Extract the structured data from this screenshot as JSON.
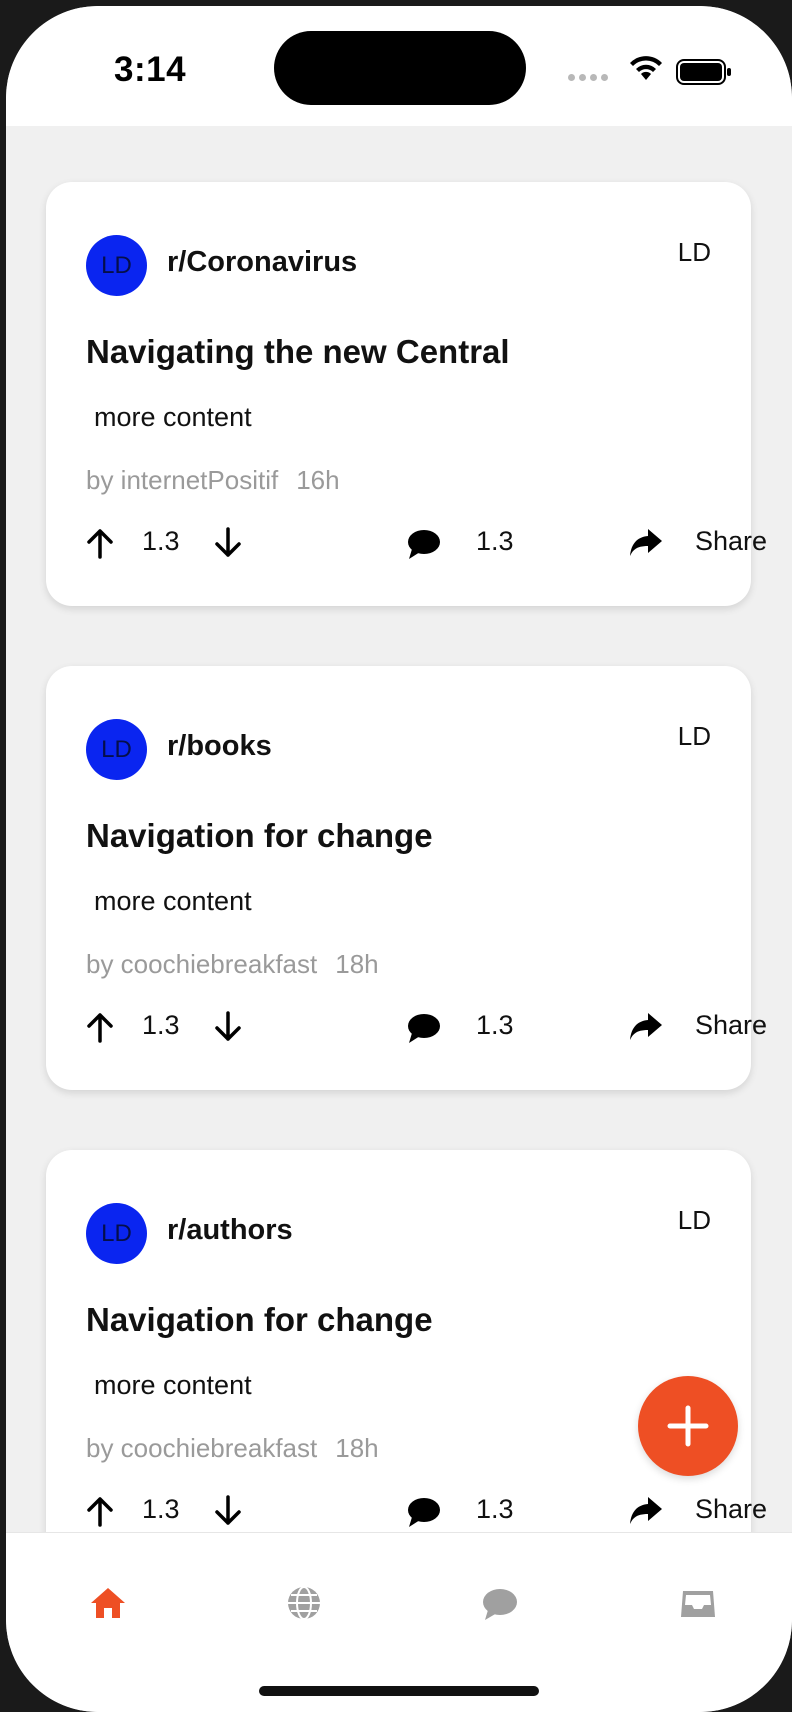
{
  "status_bar": {
    "time": "3:14"
  },
  "posts": [
    {
      "avatar_initials": "LD",
      "subreddit": "r/Coronavirus",
      "badge": "LD",
      "title": "Navigating the new Central",
      "body": "more content",
      "author": "by internetPositif",
      "time_ago": "16h",
      "votes": "1.3",
      "comments": "1.3",
      "share_label": "Share"
    },
    {
      "avatar_initials": "LD",
      "subreddit": "r/books",
      "badge": "LD",
      "title": "Navigation for change",
      "body": "more content",
      "author": "by coochiebreakfast",
      "time_ago": "18h",
      "votes": "1.3",
      "comments": "1.3",
      "share_label": "Share"
    },
    {
      "avatar_initials": "LD",
      "subreddit": "r/authors",
      "badge": "LD",
      "title": "Navigation for change",
      "body": "more content",
      "author": "by coochiebreakfast",
      "time_ago": "18h",
      "votes": "1.3",
      "comments": "1.3",
      "share_label": "Share"
    }
  ],
  "fab": {
    "icon": "plus-icon"
  },
  "tabs": [
    {
      "icon": "home-icon",
      "active": true
    },
    {
      "icon": "globe-icon",
      "active": false
    },
    {
      "icon": "chat-icon",
      "active": false
    },
    {
      "icon": "inbox-icon",
      "active": false
    }
  ],
  "colors": {
    "accent": "#ee4f24",
    "avatar": "#0a25f0",
    "inactive_tab": "#a0a0a0",
    "background": "#f0f0f0"
  }
}
